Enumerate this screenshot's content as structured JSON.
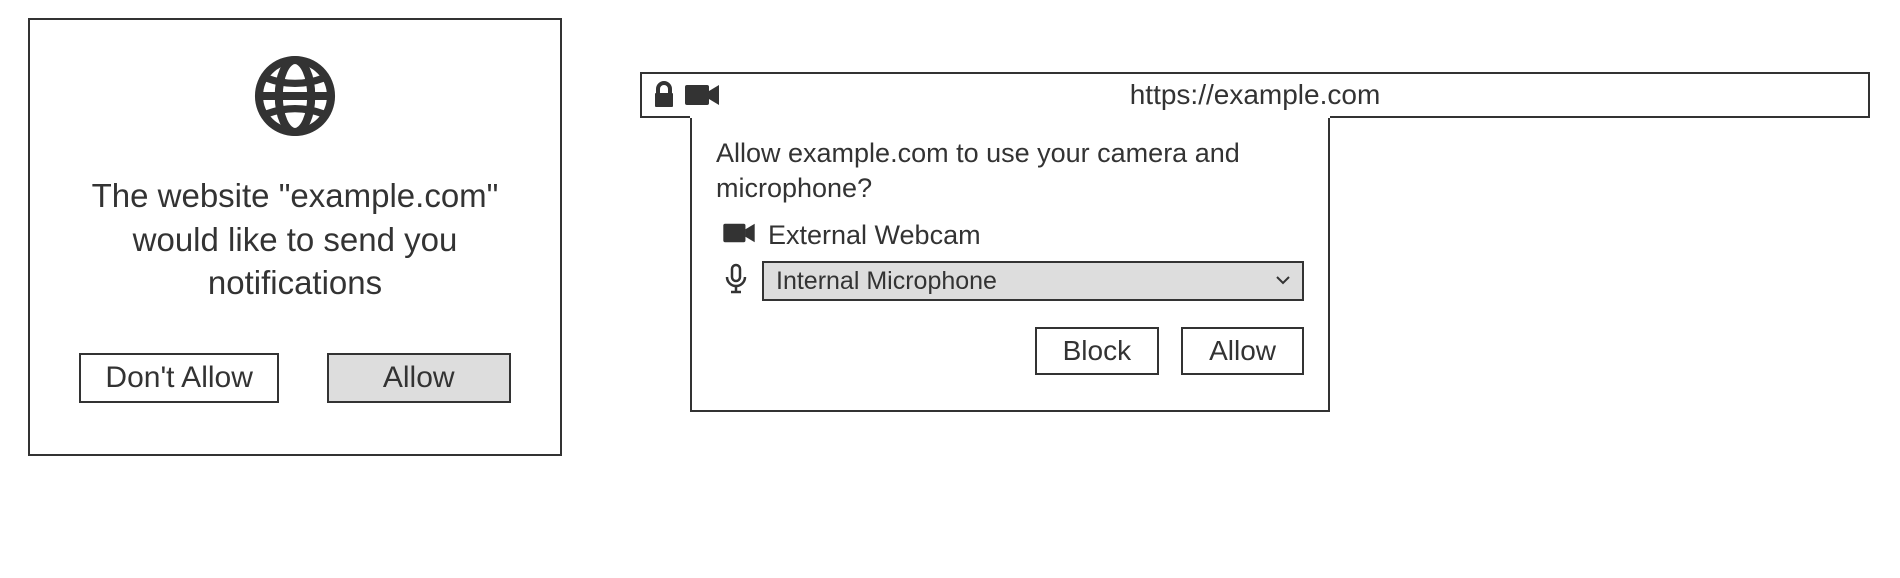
{
  "notification_dialog": {
    "message": "The website \"example.com\" would like to send you notifications",
    "dont_allow_label": "Don't Allow",
    "allow_label": "Allow",
    "icon": "globe-icon"
  },
  "urlbar": {
    "url": "https://example.com",
    "lock_icon": "lock-icon",
    "camera_icon": "camera-icon"
  },
  "camera_mic_dialog": {
    "question": "Allow example.com to use your camera and microphone?",
    "camera_device": "External Webcam",
    "microphone_device": "Internal Microphone",
    "block_label": "Block",
    "allow_label": "Allow"
  }
}
